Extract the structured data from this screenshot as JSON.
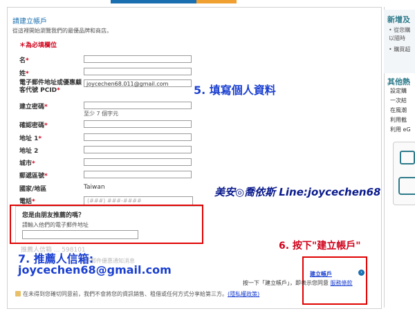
{
  "form": {
    "title": "請建立帳戶",
    "subtitle": "從這裡開始瀏覽我們的最優品牌和商店。",
    "required_note": "＊為必填欄位",
    "fields": [
      {
        "label": "名",
        "required": true,
        "value": ""
      },
      {
        "label": "姓",
        "required": true,
        "value": ""
      },
      {
        "label": "電子郵件地址或優惠顧客代號 PCID",
        "required": true,
        "value": "joycechen68.011@gmail.com"
      },
      {
        "label": "建立密碼",
        "required": true,
        "value": ""
      },
      {
        "label": "確認密碼",
        "required": true,
        "value": ""
      },
      {
        "label": "地址 1",
        "required": true,
        "value": ""
      },
      {
        "label": "地址 2",
        "required": false,
        "value": ""
      },
      {
        "label": "城市",
        "required": true,
        "value": ""
      },
      {
        "label": "郵遞區號",
        "required": true,
        "value": ""
      },
      {
        "label": "國家/地區",
        "required": false,
        "value": "Taiwan"
      },
      {
        "label": "電話",
        "required": true,
        "value": "(###) ###-####"
      }
    ],
    "password_hint": "至少 7 個字元"
  },
  "referral": {
    "title": "您是由朋友推薦的嗎？",
    "subtitle": "請輸入他們的電子郵件地址",
    "value": ""
  },
  "faded": {
    "line1": "推薦人信箱 ... 598101",
    "line2": "電子郵件優惠通知消息"
  },
  "submit": {
    "label": "建立帳戶",
    "agree_prefix": "按一下「建立帳戶」，即表示您同意",
    "agree_link": "服務條款"
  },
  "privacy": {
    "text": "在未得到您確切同意前，我們不會將您的資訊銷售、租借或任何方式分享給第三方。",
    "link": "(隱私權政策)"
  },
  "annotations": {
    "step5": "5. 填寫個人資料",
    "step6": "6. 按下\"建立帳戶\"",
    "name_tag": "美安◎喬依斯 Line:joycechen68",
    "step7_line1": "7. 推薦人信箱:",
    "step7_line2": "joycechen68@gmail.com"
  },
  "sidebar": {
    "box_title": "新增及",
    "box_lines": [
      "• 從您購",
      "以隨時",
      "• 購買超"
    ],
    "hot_title": "其他熱",
    "hot_items": [
      "設定購",
      "一次結",
      "在風潮",
      "利用截",
      "利用 eG"
    ]
  },
  "colors": {
    "accent": "#1a6fb0",
    "required": "#d0021b",
    "highlight_box": "#e00000",
    "sidebar_title": "#2c7a8a"
  }
}
